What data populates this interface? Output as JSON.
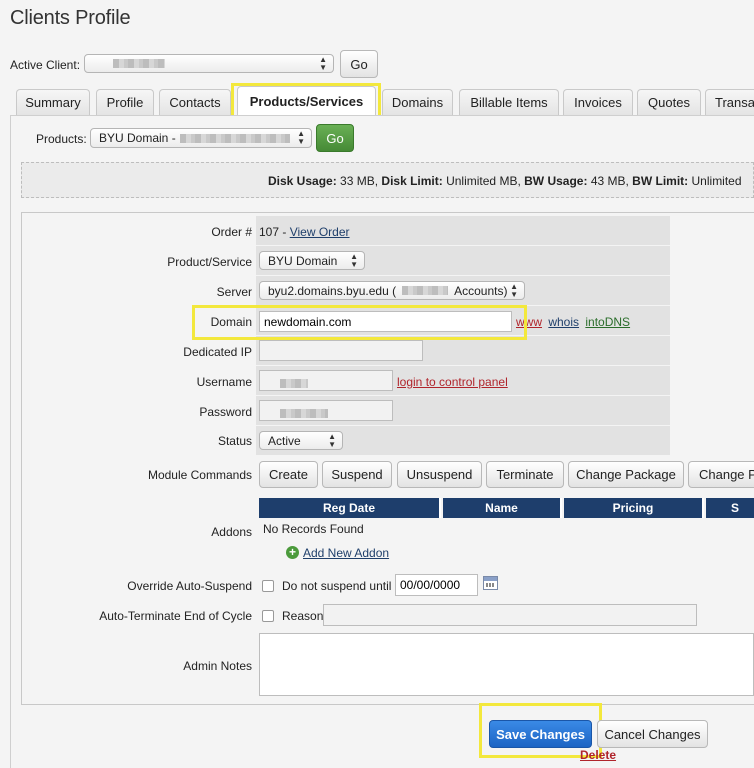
{
  "page": {
    "title": "Clients Profile"
  },
  "client_bar": {
    "label": "Active Client:",
    "go_label": "Go"
  },
  "tabs": [
    {
      "label": "Summary"
    },
    {
      "label": "Profile"
    },
    {
      "label": "Contacts"
    },
    {
      "label": "Products/Services"
    },
    {
      "label": "Domains"
    },
    {
      "label": "Billable Items"
    },
    {
      "label": "Invoices"
    },
    {
      "label": "Quotes"
    },
    {
      "label": "Transa"
    }
  ],
  "products_bar": {
    "label": "Products:",
    "selected_prefix": "BYU Domain -",
    "go_label": "Go"
  },
  "usage": {
    "disk_usage_label": "Disk Usage:",
    "disk_usage_value": "33 MB,",
    "disk_limit_label": "Disk Limit:",
    "disk_limit_value": "Unlimited MB,",
    "bw_usage_label": "BW Usage:",
    "bw_usage_value": "43 MB,",
    "bw_limit_label": "BW Limit:",
    "bw_limit_value": "Unlimited"
  },
  "form": {
    "order_label": "Order #",
    "order_number": "107 -",
    "view_order_link": "View Order",
    "product_service_label": "Product/Service",
    "product_service_value": "BYU Domain",
    "server_label": "Server",
    "server_value_prefix": "byu2.domains.byu.edu (",
    "server_value_suffix": "Accounts)",
    "domain_label": "Domain",
    "domain_value": "newdomain.com",
    "domain_links": {
      "www": "www",
      "whois": "whois",
      "intodns": "intoDNS"
    },
    "dedicated_ip_label": "Dedicated IP",
    "username_label": "Username",
    "login_link": "login to control panel",
    "password_label": "Password",
    "status_label": "Status",
    "status_value": "Active",
    "module_commands_label": "Module Commands",
    "module_buttons": [
      "Create",
      "Suspend",
      "Unsuspend",
      "Terminate",
      "Change Package",
      "Change P"
    ],
    "addons_label": "Addons",
    "addons_headers": [
      "Reg Date",
      "Name",
      "Pricing",
      "S"
    ],
    "addons_empty": "No Records Found",
    "add_addon_link": "Add New Addon",
    "override_label": "Override Auto-Suspend",
    "override_checkbox_label": "Do not suspend until",
    "override_date": "00/00/0000",
    "auto_terminate_label": "Auto-Terminate End of Cycle",
    "reason_label": "Reason",
    "admin_notes_label": "Admin Notes"
  },
  "actions": {
    "save_label": "Save Changes",
    "cancel_label": "Cancel Changes",
    "delete_label": "Delete"
  },
  "colors": {
    "highlight": "#f3e83c",
    "save_button": "#1e6fd0",
    "go_button": "#4f9a3e",
    "table_header": "#1e3e6c"
  }
}
